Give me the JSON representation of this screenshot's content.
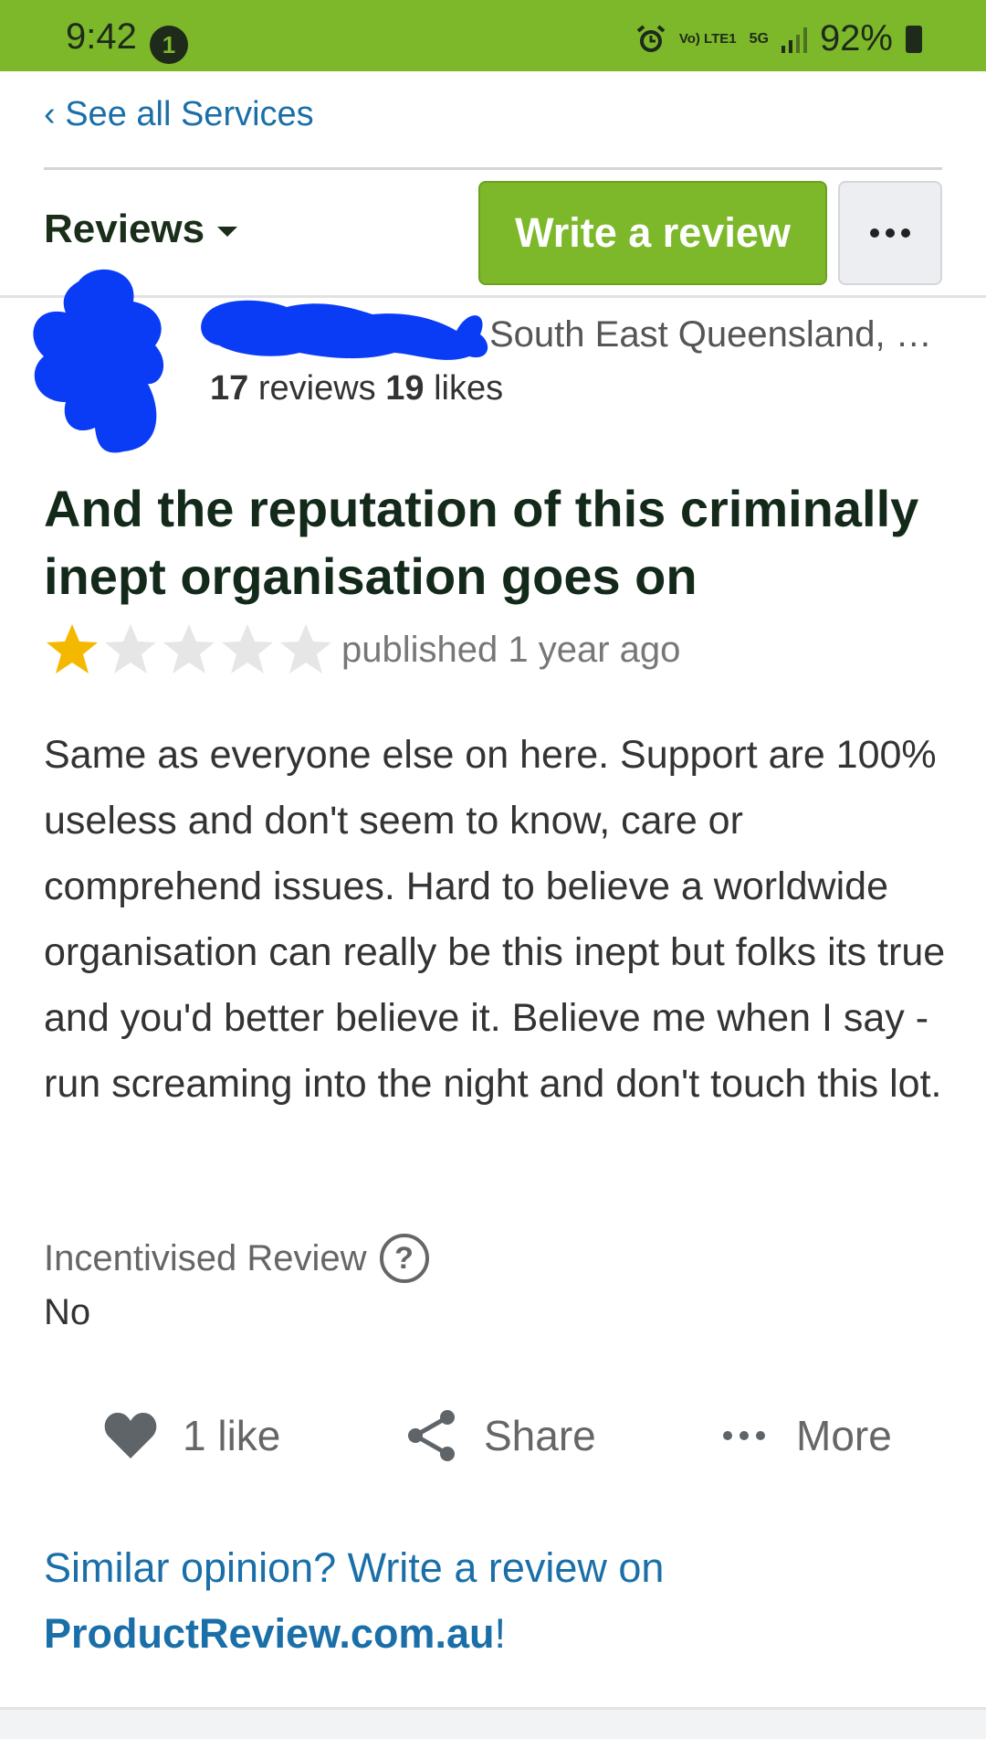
{
  "status_bar": {
    "time": "9:42",
    "notification_count": "1",
    "network_volte": "Vo) LTE1",
    "network_type": "5G",
    "battery_percent": "92%",
    "color": "#7cb82a"
  },
  "nav": {
    "back_link": "‹ See all Services"
  },
  "tabbar": {
    "reviews_label": "Reviews",
    "write_review_label": "Write a review",
    "more_icon": "ellipsis-icon"
  },
  "reviewer": {
    "location": "South East Queensland, …",
    "reviews_count": "17",
    "reviews_label": "reviews",
    "likes_count": "19",
    "likes_label": "likes"
  },
  "review": {
    "title": "And the reputation of this criminally inept organisation goes on",
    "rating": 1,
    "max_rating": 5,
    "published": "published 1 year ago",
    "body": "Same as everyone else on here. Support are 100% useless and don't seem to know, care or comprehend issues. Hard to believe a worldwide organisation can really be this inept but folks its true and you'd better believe it. Believe me when I say - run screaming into the night and don't touch this lot.",
    "incentivised_label": "Incentivised Review",
    "incentivised_value": "No"
  },
  "actions": {
    "like_label": "1 like",
    "share_label": "Share",
    "more_label": "More"
  },
  "cta": {
    "text": "Similar opinion? Write a review on",
    "site": "ProductReview.com.au",
    "suffix": "!"
  },
  "colors": {
    "brand_green": "#7cb82a",
    "link_blue": "#1a6fa8",
    "star_gold": "#f5b800",
    "title_dark": "#13291a"
  }
}
